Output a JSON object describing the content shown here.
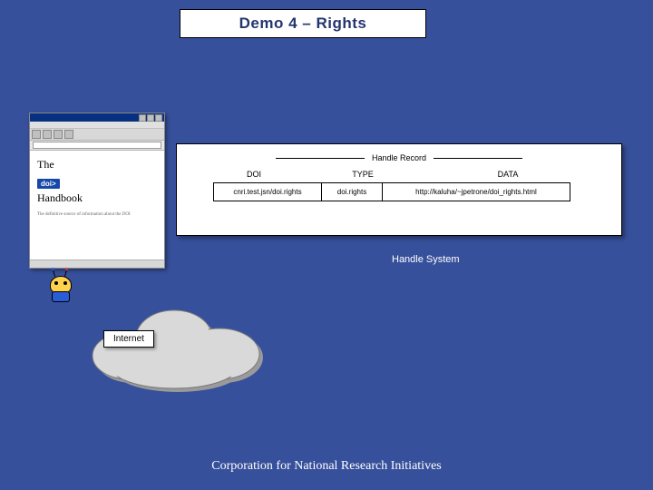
{
  "title": "Demo 4 – Rights",
  "browser": {
    "line1": "The",
    "doi_chip": "doi>",
    "line2": "Handbook",
    "subtitle": "The definitive source\nof information\nabout the DOI"
  },
  "record": {
    "heading": "Handle Record",
    "columns": {
      "c1": "DOI",
      "c2": "TYPE",
      "c3": "DATA"
    },
    "row": {
      "doi": "cnri.test.jsn/doi.rights",
      "type": "doi.rights",
      "data": "http://kaluha/~jpetrone/doi_rights.html"
    }
  },
  "labels": {
    "handle_system": "Handle System",
    "internet": "Internet"
  },
  "footer": "Corporation for National Research Initiatives"
}
